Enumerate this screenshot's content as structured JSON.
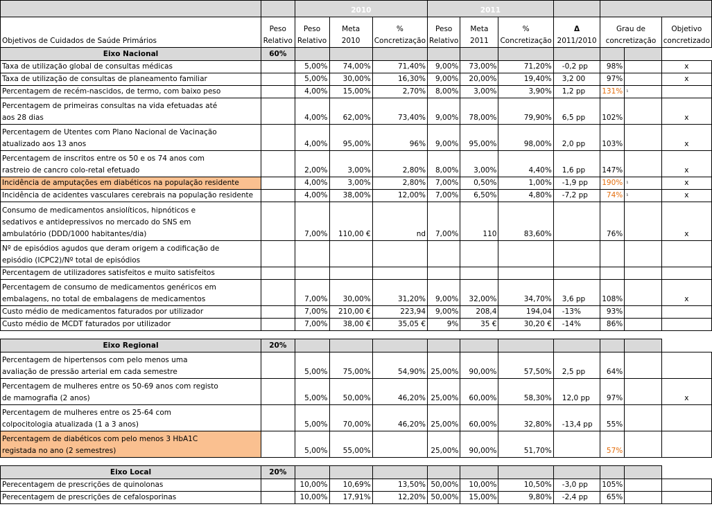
{
  "header": {
    "title": "Objetivos de Cuidados de Saúde Primários",
    "year_2010": "2010",
    "year_2011": "2011",
    "peso": "Peso",
    "relativo": "Relativo",
    "meta": "Meta",
    "meta_2010": "2010",
    "meta_2011": "2011",
    "pct_symbol": "%",
    "concretizacao": "Concretização",
    "delta_symbol": "Δ",
    "delta_period": "2011/2010",
    "grau_de": "Grau de",
    "grau_concretizacao": "concretização",
    "objetivo": "Objetivo",
    "objetivo_concretizado": "concretizado"
  },
  "sections": [
    {
      "label": "Eixo Nacional",
      "weight": "60%",
      "rows": [
        {
          "lines": [
            "Taxa de utilização global de consultas médicas"
          ],
          "p10": "5,00%",
          "m10": "74,00%",
          "c10": "71,40%",
          "p11": "9,00%",
          "m11": "73,00%",
          "c11": "71,20%",
          "delta": "-0,2 pp",
          "grau": "98%",
          "mark": "",
          "obj": "x",
          "hl": false,
          "orange": false
        },
        {
          "lines": [
            "Taxa de utilização de consultas de planeamento familiar"
          ],
          "p10": "5,00%",
          "m10": "30,00%",
          "c10": "16,30%",
          "p11": "9,00%",
          "m11": "20,00%",
          "c11": "19,40%",
          "delta": "3,2 00",
          "grau": "97%",
          "mark": "",
          "obj": "x",
          "hl": false,
          "orange": false
        },
        {
          "lines": [
            "Percentagem de recém-nascidos, de termo, com baixo peso"
          ],
          "p10": "4,00%",
          "m10": "15,00%",
          "c10": "2,70%",
          "p11": "8,00%",
          "m11": "3,00%",
          "c11": "3,90%",
          "delta": "1,2 pp",
          "grau": "131%",
          "mark": "¹",
          "obj": "",
          "hl": false,
          "orange": true
        },
        {
          "lines": [
            "Percentagem de primeiras consultas na vida efetuadas até",
            "aos 28 dias"
          ],
          "p10": "4,00%",
          "m10": "62,00%",
          "c10": "73,40%",
          "p11": "9,00%",
          "m11": "78,00%",
          "c11": "79,90%",
          "delta": "6,5 pp",
          "grau": "102%",
          "mark": "",
          "obj": "x",
          "hl": false,
          "orange": false
        },
        {
          "lines": [
            "Percentagem de Utentes com Plano Nacional de Vacinação",
            "atualizado aos 13 anos"
          ],
          "p10": "4,00%",
          "m10": "95,00%",
          "c10": "96%",
          "p11": "9,00%",
          "m11": "95,00%",
          "c11": "98,00%",
          "delta": "2,0 pp",
          "grau": "103%",
          "mark": "",
          "obj": "x",
          "hl": false,
          "orange": false
        },
        {
          "lines": [
            "Percentagem de inscritos entre os 50 e os 74 anos com",
            "rastreio de cancro colo-retal efetuado"
          ],
          "p10": "2,00%",
          "m10": "3,00%",
          "c10": "2,80%",
          "p11": "8,00%",
          "m11": "3,00%",
          "c11": "4,40%",
          "delta": "1,6 pp",
          "grau": "147%",
          "mark": "",
          "obj": "x",
          "hl": false,
          "orange": false
        },
        {
          "lines": [
            "Incidência de amputações em diabéticos na população residente"
          ],
          "p10": "4,00%",
          "m10": "3,00%",
          "c10": "2,80%",
          "p11": "7,00%",
          "m11": "0,50%",
          "c11": "1,00%",
          "delta": "-1,9 pp",
          "grau": "190%",
          "mark": "¹",
          "obj": "x",
          "hl": true,
          "orange": true
        },
        {
          "lines": [
            "Incidência de acidentes vasculares cerebrais na população residente"
          ],
          "p10": "4,00%",
          "m10": "38,00%",
          "c10": "12,00%",
          "p11": "7,00%",
          "m11": "6,50%",
          "c11": "4,80%",
          "delta": "-7,2 pp",
          "grau": "74%",
          "mark": "¹",
          "obj": "x",
          "hl": false,
          "orange": true
        },
        {
          "lines": [
            "Consumo de medicamentos ansiolíticos, hipnóticos e",
            "sedativos e antidepressivos no mercado do SNS em",
            "ambulatório (DDD/1000 habitantes/dia)"
          ],
          "p10": "7,00%",
          "m10": "110,00 €",
          "c10": "nd",
          "p11": "7,00%",
          "m11": "110",
          "c11": "83,60%",
          "delta": "",
          "grau": "76%",
          "mark": "",
          "obj": "x",
          "hl": false,
          "orange": false
        },
        {
          "lines": [
            "Nº de episódios agudos que deram origem a codificação de",
            "episódio (ICPC2)/Nº total de episódios"
          ],
          "p10": "",
          "m10": "",
          "c10": "",
          "p11": "",
          "m11": "",
          "c11": "",
          "delta": "",
          "grau": "",
          "mark": "",
          "obj": "",
          "hl": false,
          "orange": false
        },
        {
          "lines": [
            "Percentagem de utilizadores satisfeitos e muito satisfeitos"
          ],
          "p10": "",
          "m10": "",
          "c10": "",
          "p11": "",
          "m11": "",
          "c11": "",
          "delta": "",
          "grau": "",
          "mark": "",
          "obj": "",
          "hl": false,
          "orange": false
        },
        {
          "lines": [
            "Percentagem de consumo de medicamentos genéricos em",
            "embalagens, no total de embalagens de medicamentos"
          ],
          "p10": "7,00%",
          "m10": "30,00%",
          "c10": "31,20%",
          "p11": "9,00%",
          "m11": "32,00%",
          "c11": "34,70%",
          "delta": "3,6 pp",
          "grau": "108%",
          "mark": "",
          "obj": "x",
          "hl": false,
          "orange": false
        },
        {
          "lines": [
            "Custo médio de medicamentos faturados por utilizador"
          ],
          "p10": "7,00%",
          "m10": "210,00 €",
          "c10": "223,94",
          "p11": "9,00%",
          "m11": "208,4",
          "c11": "194,04",
          "delta": "-13%",
          "grau": "93%",
          "mark": "",
          "obj": "",
          "hl": false,
          "orange": false
        },
        {
          "lines": [
            "Custo médio de MCDT faturados por utilizador"
          ],
          "p10": "7,00%",
          "m10": "38,00 €",
          "c10": "35,05 €",
          "p11": "9%",
          "m11": "35 €",
          "c11": "30,20 €",
          "delta": "-14%",
          "grau": "86%",
          "mark": "",
          "obj": "",
          "hl": false,
          "orange": false
        }
      ]
    },
    {
      "label": "Eixo Regional",
      "weight": "20%",
      "rows": [
        {
          "lines": [
            "Percentagem de hipertensos com pelo menos uma",
            "avaliação de pressão arterial em cada semestre"
          ],
          "p10": "5,00%",
          "m10": "75,00%",
          "c10": "54,90%",
          "p11": "25,00%",
          "m11": "90,00%",
          "c11": "57,50%",
          "delta": "2,5 pp",
          "grau": "64%",
          "mark": "",
          "obj": "",
          "hl": false,
          "orange": false
        },
        {
          "lines": [
            "Percentagem de mulheres entre os 50-69 anos com registo",
            "de mamografia (2 anos)"
          ],
          "p10": "5,00%",
          "m10": "50,00%",
          "c10": "46,20%",
          "p11": "25,00%",
          "m11": "60,00%",
          "c11": "58,30%",
          "delta": "12,0 pp",
          "grau": "97%",
          "mark": "",
          "obj": "x",
          "hl": false,
          "orange": false
        },
        {
          "lines": [
            "Percentagem de mulheres entre os 25-64 com",
            "colpocitologia atualizada (1 a 3  anos)"
          ],
          "p10": "5,00%",
          "m10": "70,00%",
          "c10": "46,20%",
          "p11": "25,00%",
          "m11": "60,00%",
          "c11": "32,80%",
          "delta": "-13,4 pp",
          "grau": "55%",
          "mark": "",
          "obj": "",
          "hl": false,
          "orange": false
        },
        {
          "lines": [
            "Percentagem de diabéticos com pelo menos 3 HbA1C",
            "registada no ano (2 semestres)"
          ],
          "p10": "5,00%",
          "m10": "55,00%",
          "c10": "",
          "p11": "25,00%",
          "m11": "90,00%",
          "c11": "51,70%",
          "delta": "",
          "grau": "57%",
          "mark": "",
          "obj": "",
          "hl": true,
          "orange": true
        }
      ]
    },
    {
      "label": "Eixo Local",
      "weight": "20%",
      "rows": [
        {
          "lines": [
            "Perecentagem de prescrições de quinolonas"
          ],
          "p10": "10,00%",
          "m10": "10,69%",
          "c10": "13,50%",
          "p11": "50,00%",
          "m11": "10,00%",
          "c11": "10,50%",
          "delta": "-3,0 pp",
          "grau": "105%",
          "mark": "",
          "obj": "",
          "hl": false,
          "orange": false
        },
        {
          "lines": [
            "Perecentagem de prescrições de cefalosporinas"
          ],
          "p10": "10,00%",
          "m10": "17,91%",
          "c10": "12,20%",
          "p11": "50,00%",
          "m11": "15,00%",
          "c11": "9,80%",
          "delta": "-2,4 pp",
          "grau": "65%",
          "mark": "",
          "obj": "",
          "hl": false,
          "orange": false
        }
      ]
    }
  ]
}
